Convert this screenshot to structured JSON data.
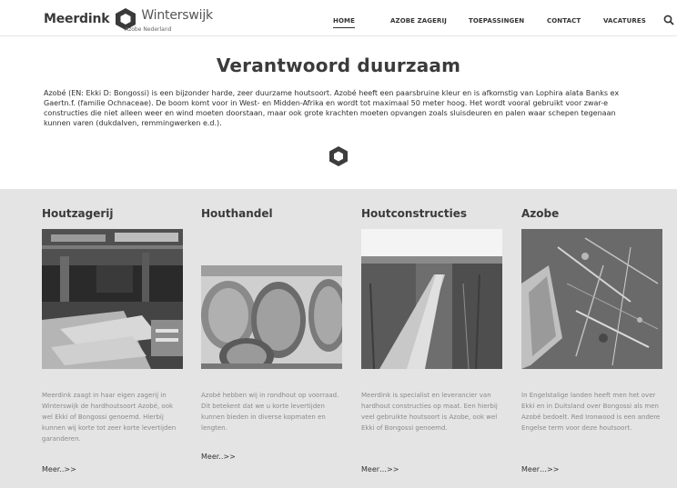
{
  "header": {
    "logo_left": "Meerdink",
    "logo_right": "Winterswijk",
    "logo_sub": "Azobe Nederland",
    "nav": [
      {
        "label": "HOME",
        "active": true
      },
      {
        "label": "AZOBE ZAGERIJ",
        "active": false
      },
      {
        "label": "TOEPASSINGEN",
        "active": false
      },
      {
        "label": "CONTACT",
        "active": false
      },
      {
        "label": "VACATURES",
        "active": false
      }
    ],
    "search_icon": "search-icon"
  },
  "intro": {
    "title": "Verantwoord duurzaam",
    "text": "Azobé (EN: Ekki D: Bongossi) is een bijzonder harde, zeer duurzame houtsoort. Azobé heeft een paarsbruine kleur en is afkomstig van Lophira alata Banks ex Gaertn.f. (familie Ochnaceae). De boom komt voor in West- en Midden-Afrika en wordt tot maximaal 50 meter hoog. Het wordt vooral gebruikt voor zwar-e constructies die niet alleen weer en wind moeten doorstaan, maar ook grote krachten moeten opvangen zoals sluisdeuren en palen waar schepen tegenaan kunnen varen (dukdalven, remmingwerken e.d.).",
    "hex_icon": "hexagon-logo-icon"
  },
  "columns": [
    {
      "title": "Houtzagerij",
      "image": "sawmill-interior-photo",
      "text": "Meerdink zaagt in haar eigen zagerij in Winterswijk de hardhoutsoort Azobé, ook wel Ekki of Bongossi genoemd. Hierbij kunnen wij korte tot zeer korte levertijden garanderen.",
      "more": "Meer..>>"
    },
    {
      "title": "Houthandel",
      "image": "log-pile-photo",
      "text": "Azobé hebben wij in rondhout op voorraad. Dit betekent dat we u korte levertijden kunnen bieden in diverse kopmaten en lengten.",
      "more": "Meer..>>"
    },
    {
      "title": "Houtconstructies",
      "image": "boardwalk-photo",
      "text": "Meerdink is specialist en leverancier van hardhout constructies op maat. Een hierbij veel gebruikte houtsoort is Azobe, ook wel Ekki of Bongossi genoemd.",
      "more": "Meer…>>"
    },
    {
      "title": "Azobe",
      "image": "wood-chips-photo",
      "text": "In Engelstalige landen heeft men het over Ekki en in Duitsland over Bongossi als men Azobé bedoelt. Red Ironwood is een andere Engelse term voor deze houtsoort.",
      "more": "Meer…>>"
    }
  ],
  "colors": {
    "section_bg": "#e4e4e4",
    "text_dark": "#333333",
    "text_muted": "#8a8a8a"
  }
}
